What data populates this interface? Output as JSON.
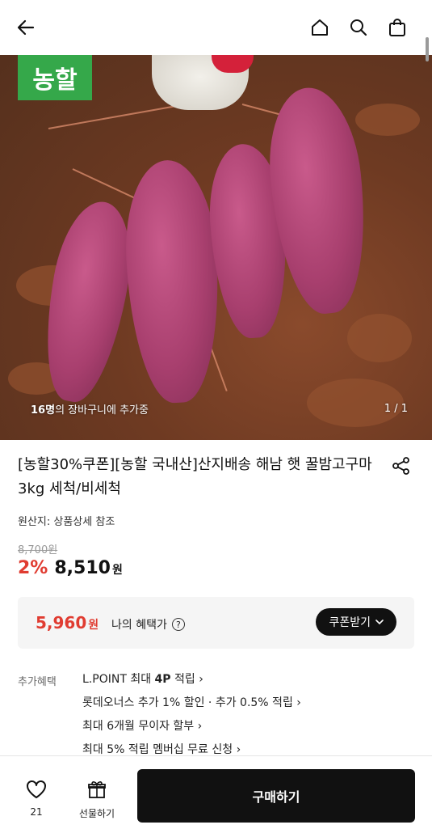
{
  "header": {
    "icons": [
      "back-arrow-icon",
      "home-icon",
      "search-icon",
      "shopping-bag-icon"
    ]
  },
  "hero": {
    "brand_badge": "농할",
    "cart_count": "16명",
    "cart_note_suffix": "의 장바구니에 추가중",
    "counter": "1 / 1"
  },
  "product": {
    "title": "[농할30%쿠폰][농할 국내산]산지배송 해남 햇 꿀밤고구마 3kg 세척/비세척",
    "origin": "원산지: 상품상세 참조",
    "original_price": "8,700원",
    "discount": "2%",
    "price": "8,510",
    "currency": "원"
  },
  "benefit": {
    "price": "5,960",
    "currency": "원",
    "label": "나의 혜택가",
    "help": "?",
    "coupon_button": "쿠폰받기"
  },
  "extra_benefits": {
    "label": "추가혜택",
    "items": [
      {
        "prefix": "L.POINT 최대 ",
        "bold": "4P",
        "suffix": " 적립 ›"
      },
      {
        "prefix": "롯데오너스 추가 1% 할인 · 추가 0.5% 적립 ›",
        "bold": "",
        "suffix": ""
      },
      {
        "prefix": "최대 6개월 무이자 할부 ›",
        "bold": "",
        "suffix": ""
      },
      {
        "prefix": "최대 5% 적립 멤버십 무료 신청 ›",
        "bold": "",
        "suffix": ""
      }
    ]
  },
  "bottom": {
    "like_count": "21",
    "gift_label": "선물하기",
    "buy_button": "구매하기"
  },
  "colors": {
    "accent_red": "#e03c31",
    "brand_green": "#35a84a",
    "button_dark": "#111111"
  }
}
